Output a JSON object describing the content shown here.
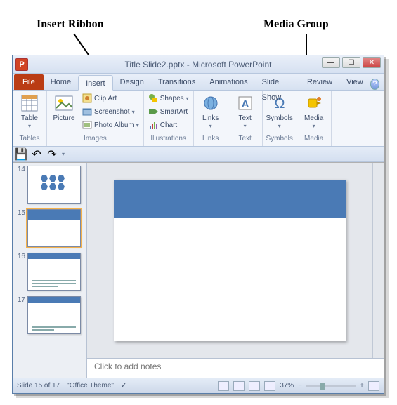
{
  "annotations": {
    "insert": "Insert Ribbon",
    "media": "Media Group"
  },
  "title": "Title Slide2.pptx - Microsoft PowerPoint",
  "app_icon_letter": "P",
  "tabs": {
    "file": "File",
    "home": "Home",
    "insert": "Insert",
    "design": "Design",
    "transitions": "Transitions",
    "animations": "Animations",
    "slideshow": "Slide Show",
    "review": "Review",
    "view": "View"
  },
  "ribbon": {
    "tables": {
      "label": "Tables",
      "table": "Table"
    },
    "images": {
      "label": "Images",
      "picture": "Picture",
      "clipart": "Clip Art",
      "screenshot": "Screenshot",
      "photoalbum": "Photo Album"
    },
    "illustrations": {
      "label": "Illustrations",
      "shapes": "Shapes",
      "smartart": "SmartArt",
      "chart": "Chart"
    },
    "links": {
      "label": "Links",
      "btn": "Links"
    },
    "text": {
      "label": "Text",
      "btn": "Text"
    },
    "symbols": {
      "label": "Symbols",
      "btn": "Symbols"
    },
    "media": {
      "label": "Media",
      "btn": "Media"
    }
  },
  "thumbs": [
    {
      "num": "14"
    },
    {
      "num": "15"
    },
    {
      "num": "16"
    },
    {
      "num": "17"
    }
  ],
  "notes_placeholder": "Click to add notes",
  "status": {
    "slide": "Slide 15 of 17",
    "theme": "\"Office Theme\"",
    "zoom": "37%"
  },
  "icons": {
    "caret": "▾",
    "help": "?",
    "minimize": "—",
    "maximize": "☐",
    "close": "✕",
    "plus": "+",
    "minus": "−",
    "undo": "↶",
    "redo": "↷",
    "save": "💾"
  }
}
